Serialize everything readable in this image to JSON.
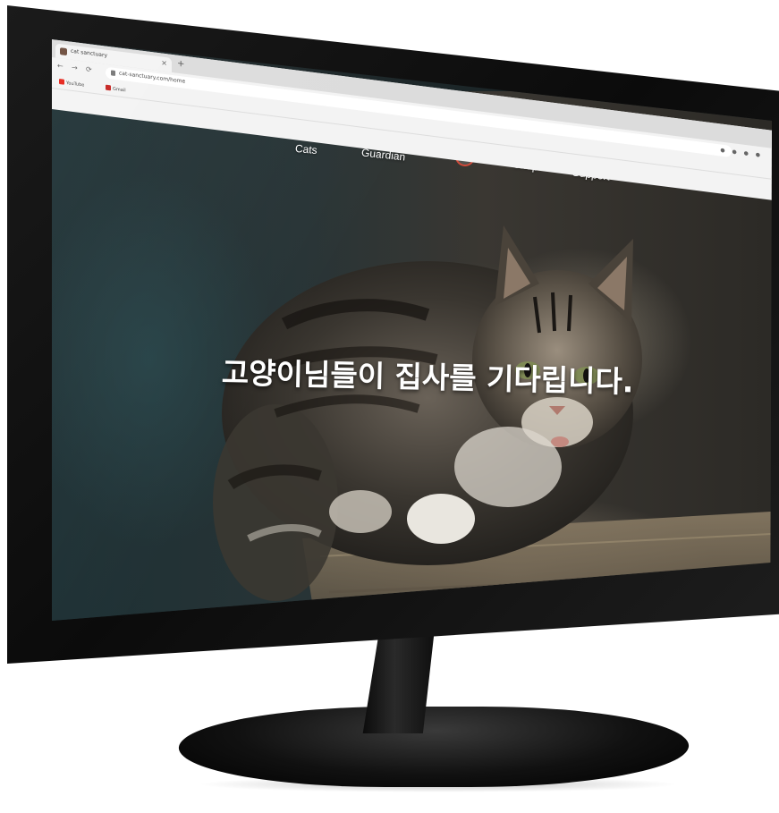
{
  "browser": {
    "tab_title": "cat sanctuary",
    "tab_close": "×",
    "new_tab": "+",
    "back": "←",
    "forward": "→",
    "reload": "⟳",
    "url": "cat-sanctuary.com/home",
    "toolbar_icons": "● ● ● ●",
    "bookmarks": [
      {
        "label": "YouTube",
        "color": "#e62117"
      },
      {
        "label": "Gmail",
        "color": "#c5221f"
      }
    ]
  },
  "site": {
    "nav": {
      "cats": "Cats",
      "guardian": "Guardian",
      "shop": "Shop",
      "support": "Support"
    },
    "hero_headline": "고양이님들이 집사를 기다립니다."
  },
  "colors": {
    "accent": "#d24a3a",
    "nav_text": "#ffffff"
  }
}
